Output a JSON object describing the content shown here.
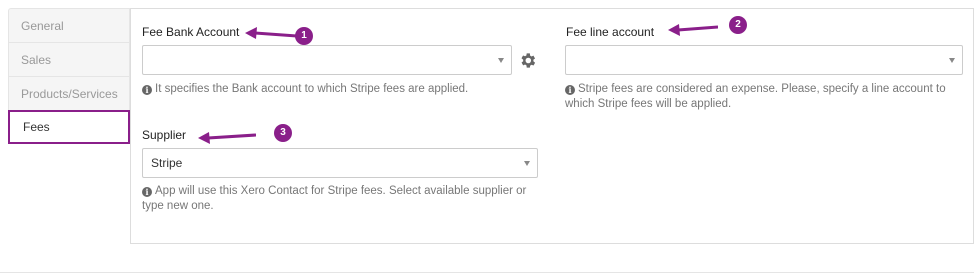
{
  "tabs": [
    {
      "label": "General"
    },
    {
      "label": "Sales"
    },
    {
      "label": "Products/Services"
    },
    {
      "label": "Fees"
    }
  ],
  "fee_bank_account": {
    "label": "Fee Bank Account",
    "value": "",
    "help": "It specifies the Bank account to which Stripe fees are applied."
  },
  "fee_line_account": {
    "label": "Fee line account",
    "value": "",
    "help_line1": "Stripe fees are considered an expense. Please, specify a line account to",
    "help_line2": "which Stripe fees will be applied."
  },
  "supplier": {
    "label": "Supplier",
    "value": "Stripe",
    "help_line1": "App will use this Xero Contact for Stripe fees. Select available supplier or",
    "help_line2": "type new one."
  },
  "annotations": {
    "badge1": "1",
    "badge2": "2",
    "badge3": "3",
    "color": "#8a1f8a"
  },
  "icons": {
    "info": "info-circle",
    "gear": "gear"
  }
}
